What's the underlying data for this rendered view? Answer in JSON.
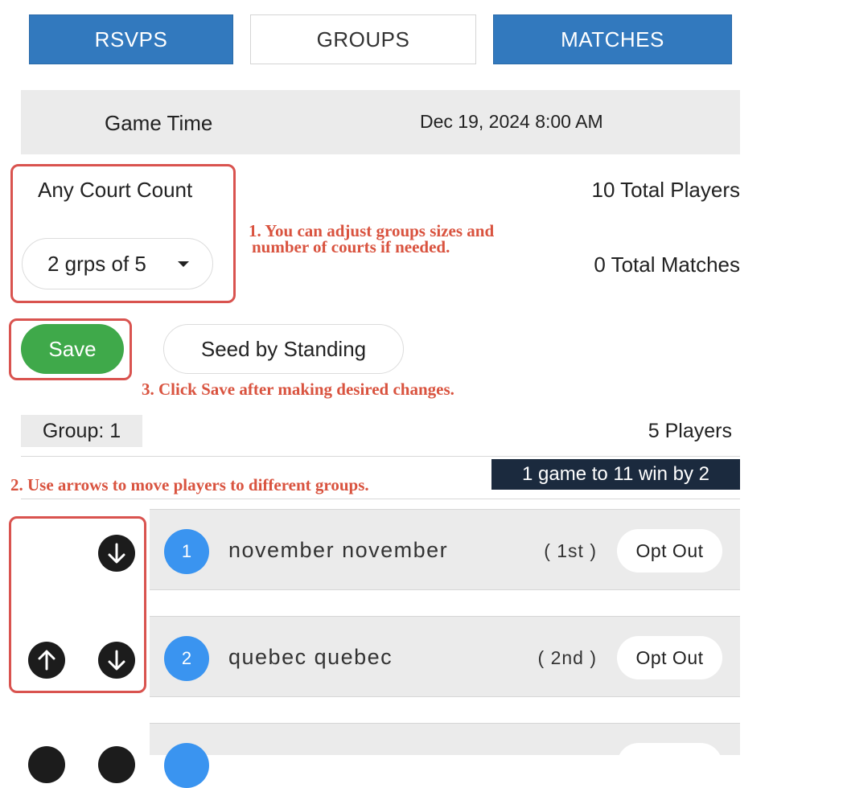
{
  "tabs": [
    {
      "label": "RSVPS"
    },
    {
      "label": "GROUPS"
    },
    {
      "label": "MATCHES"
    }
  ],
  "game_time": {
    "label": "Game Time",
    "value": "Dec 19, 2024 8:00 AM"
  },
  "court": {
    "label": "Any Court Count",
    "selected": "2 grps of 5"
  },
  "stats": {
    "total_players": "10 Total Players",
    "total_matches": "0 Total Matches"
  },
  "actions": {
    "save_label": "Save",
    "seed_label": "Seed by Standing"
  },
  "group": {
    "label": "Group: 1",
    "players_count": "5 Players",
    "format": "1 game to 11 win by 2"
  },
  "players": [
    {
      "seed": "1",
      "name": "november november",
      "rank": "( 1st )",
      "opt_out": "Opt Out"
    },
    {
      "seed": "2",
      "name": "quebec quebec",
      "rank": "( 2nd )",
      "opt_out": "Opt Out"
    }
  ],
  "annotations": {
    "note1_line1": "1. You can adjust groups sizes and",
    "note1_line2": "number of courts if needed.",
    "note2": "2. Use arrows to move players to different groups.",
    "note3": "3. Click Save after making desired changes."
  },
  "colors": {
    "tab_blue": "#3279be",
    "save_green": "#3fa94a",
    "seed_blue": "#3a94f0",
    "annotation_red": "#d9533f",
    "badge_navy": "#1b2a3e"
  },
  "icons": {
    "move_up": "arrow-up-circle-icon",
    "move_down": "arrow-down-circle-icon",
    "dropdown": "caret-down-icon"
  }
}
